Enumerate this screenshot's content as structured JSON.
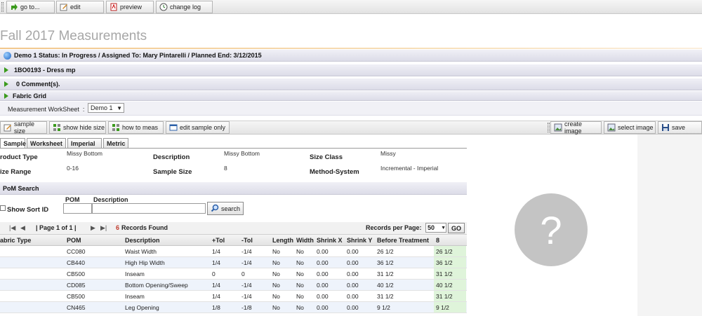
{
  "toolbar": {
    "goto_label": "go to...",
    "edit_label": "edit",
    "preview_label": "preview",
    "changelog_label": "change log"
  },
  "page_title": "Fall 2017 Measurements",
  "sections": {
    "status": "Demo 1  Status: In Progress / Assigned To: Mary Pintarelli / Planned End: 3/12/2015",
    "product": "1BO0193 - Dress mp",
    "comments": "0 Comment(s).",
    "fabric_grid": "Fabric Grid"
  },
  "worksheet": {
    "label": "Measurement WorkSheet",
    "colon": ":",
    "selected": "Demo 1"
  },
  "toolbar2": {
    "sample_size": "sample size",
    "show_hide_size": "show hide size",
    "how_to_meas": "how to meas",
    "edit_sample_only": "edit sample only",
    "create_image": "create image",
    "select_image": "select image",
    "save": "save"
  },
  "tabs": [
    "Sample",
    "Worksheet",
    "Imperial",
    "Metric"
  ],
  "info": {
    "product_type_label": "roduct Type",
    "product_type_value": "Missy Bottom",
    "description_label": "Description",
    "description_value": "Missy Bottom",
    "size_class_label": "Size Class",
    "size_class_value": "Missy",
    "size_range_label": "ize Range",
    "size_range_value": "0-16",
    "sample_size_label": "Sample Size",
    "sample_size_value": "8",
    "method_label": "Method-System",
    "method_value": "Incremental - Imperial"
  },
  "pom_search": {
    "title": "PoM Search",
    "pom_label": "POM",
    "description_label": "Description",
    "show_sort_label": "Show Sort ID",
    "search_label": "search"
  },
  "pager": {
    "page_text": "| Page 1 of 1 |",
    "records_count": "6",
    "records_text": "Records Found",
    "rpp_label": "Records per Page:",
    "rpp_value": "50",
    "go_label": "GO"
  },
  "grid": {
    "headers": [
      "abric Type",
      "POM",
      "Description",
      "+Tol",
      "-Tol",
      "Length",
      "Width",
      "Shrink X",
      "Shrink Y",
      "Before Treatment",
      "8"
    ],
    "rows": [
      [
        "",
        "CC080",
        "Waist Width",
        "1/4",
        "-1/4",
        "No",
        "No",
        "0.00",
        "0.00",
        "26 1/2",
        "26 1/2"
      ],
      [
        "",
        "CB440",
        "High Hip Width",
        "1/4",
        "-1/4",
        "No",
        "No",
        "0.00",
        "0.00",
        "36 1/2",
        "36 1/2"
      ],
      [
        "",
        "CB500",
        "Inseam",
        "0",
        "0",
        "No",
        "No",
        "0.00",
        "0.00",
        "31 1/2",
        "31 1/2"
      ],
      [
        "",
        "CD085",
        "Bottom Opening/Sweep",
        "1/4",
        "-1/4",
        "No",
        "No",
        "0.00",
        "0.00",
        "40 1/2",
        "40 1/2"
      ],
      [
        "",
        "CB500",
        "Inseam",
        "1/4",
        "-1/4",
        "No",
        "No",
        "0.00",
        "0.00",
        "31 1/2",
        "31 1/2"
      ],
      [
        "",
        "CN465",
        "Leg Opening",
        "1/8",
        "-1/8",
        "No",
        "No",
        "0.00",
        "0.00",
        "9 1/2",
        "9 1/2"
      ]
    ]
  },
  "image_placeholder": "?",
  "colors": {
    "title_gray": "#a7a7a7",
    "accent_green": "#3a9a1c",
    "records_red": "#c0392b",
    "highlight_green": "#dff4da"
  }
}
